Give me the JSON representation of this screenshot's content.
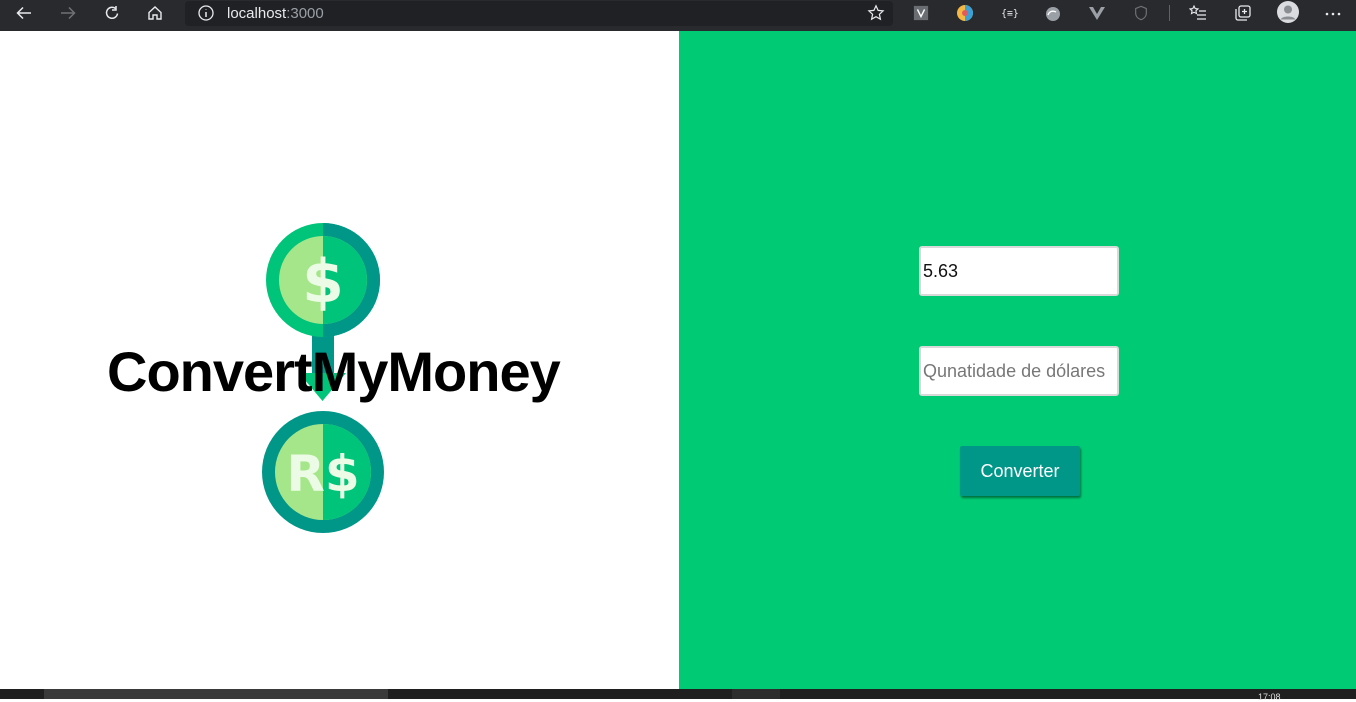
{
  "browser": {
    "url_host": "localhost",
    "url_port": ":3000",
    "icons": [
      "back-icon",
      "forward-icon",
      "reload-icon",
      "home-icon",
      "site-info-icon",
      "favorite-star-icon",
      "extension-v-icon",
      "extension-palette-icon",
      "extension-brackets-icon",
      "extension-cloud-icon",
      "extension-vue-icon",
      "extension-shield-icon",
      "favorites-list-icon",
      "collections-icon",
      "profile-avatar-icon",
      "more-icon"
    ]
  },
  "brand": {
    "title": "ConvertMyMoney",
    "logo_top_symbol": "$",
    "logo_bottom_symbol": "R$"
  },
  "form": {
    "rate_value": "5.63",
    "dollars_placeholder": "Qunatidade de dólares",
    "convert_label": "Converter"
  },
  "taskbar": {
    "clock": "17:08"
  },
  "colors": {
    "panel_green": "#00cb74",
    "button_teal": "#009688",
    "coin_dark": "#009688",
    "coin_light": "#a6e68a",
    "coin_mid": "#00c47a"
  }
}
